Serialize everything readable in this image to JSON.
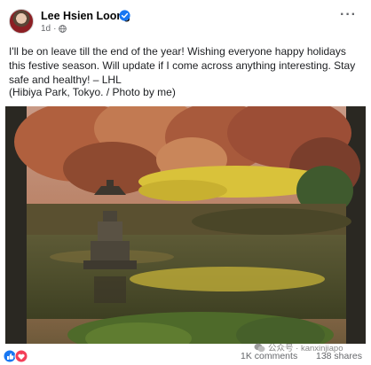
{
  "post": {
    "author": "Lee Hsien Loong",
    "time": "1d",
    "text": "I'll be on leave till the end of the year! Wishing everyone happy holidays this festive season. Will update if I come across anything interesting. Stay safe and healthy! – LHL",
    "caption": "(Hibiya Park, Tokyo. / Photo by me)"
  },
  "engagement": {
    "comments": "1K comments",
    "shares": "138 shares"
  },
  "watermark": "公众号 · kanxinjiapo",
  "icons": {
    "verified": "verified-badge-icon",
    "privacy": "globe-icon",
    "more": "more-options-icon",
    "reaction_like": "like-reaction-icon",
    "reaction_love": "love-reaction-icon",
    "watermark": "wechat-icon"
  },
  "colors": {
    "like": "#1877f2",
    "love": "#f33e58",
    "verified": "#1877f2"
  }
}
